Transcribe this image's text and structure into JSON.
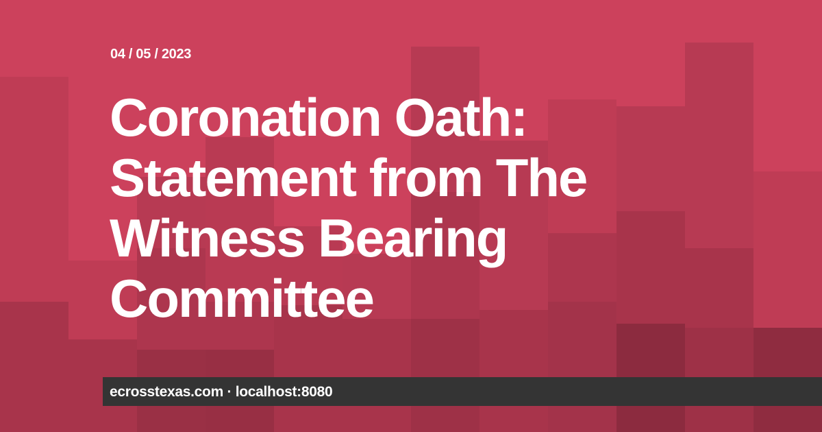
{
  "date": "04 / 05 / 2023",
  "title": "Coronation Oath: Statement from The Witness Bearing Committee",
  "footer": {
    "text": "ecrosstexas.com · localhost:8080"
  },
  "colors": {
    "background": "#cc415c",
    "footer_bar": "#343434",
    "text": "#ffffff"
  }
}
